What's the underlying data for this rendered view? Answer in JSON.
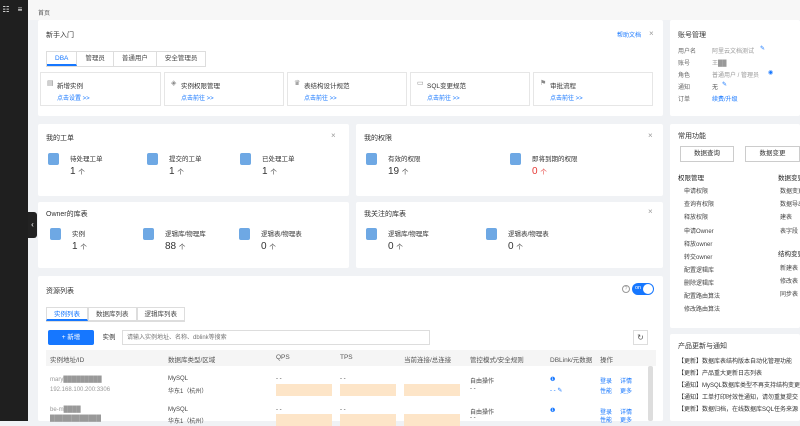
{
  "breadcrumb": "首页",
  "getting_started": {
    "title": "新手入门",
    "help_link": "帮助文档",
    "tabs": [
      "DBA",
      "管理员",
      "普通用户",
      "安全管理员"
    ],
    "items": [
      {
        "title": "新增实例",
        "link": "点击设置 >>"
      },
      {
        "title": "实例权限管理",
        "link": "点击前往 >>"
      },
      {
        "title": "表结构设计规范",
        "link": "点击前往 >>"
      },
      {
        "title": "SQL变更规范",
        "link": "点击前往 >>"
      },
      {
        "title": "审批流程",
        "link": "点击前往 >>"
      }
    ]
  },
  "my_tickets": {
    "title": "我的工单",
    "items": [
      {
        "label": "待处理工单",
        "count": "1",
        "unit": "个"
      },
      {
        "label": "提交的工单",
        "count": "1",
        "unit": "个"
      },
      {
        "label": "已处理工单",
        "count": "1",
        "unit": "个"
      }
    ]
  },
  "my_permissions": {
    "title": "我的权限",
    "items": [
      {
        "label": "有效的权限",
        "count": "19",
        "unit": "个"
      },
      {
        "label": "即将到期的权限",
        "count": "0",
        "unit": "个"
      }
    ]
  },
  "owner_dbs": {
    "title": "Owner的库表",
    "items": [
      {
        "label": "实例",
        "count": "1",
        "unit": "个"
      },
      {
        "label": "逻辑库/物理库",
        "count": "88",
        "unit": "个"
      },
      {
        "label": "逻辑表/物理表",
        "count": "0",
        "unit": "个"
      }
    ]
  },
  "followed_dbs": {
    "title": "我关注的库表",
    "items": [
      {
        "label": "逻辑库/物理库",
        "count": "0",
        "unit": "个"
      },
      {
        "label": "逻辑表/物理表",
        "count": "0",
        "unit": "个"
      }
    ]
  },
  "resources": {
    "title": "资源列表",
    "toggle": "on",
    "tabs": [
      "实例列表",
      "数据库列表",
      "逻辑库列表"
    ],
    "new_button": "+ 新增",
    "filter_label": "实例",
    "search_placeholder": "请输入实例地址、名称、dblink等搜索",
    "columns": [
      "实例地址/ID",
      "数据库类型/区域",
      "QPS",
      "TPS",
      "当前连接/总连接",
      "管控模式/安全规则",
      "DBLink/元数据",
      "操作"
    ],
    "rows": [
      {
        "addr": "mary█████████",
        "sub": "192.168.100.200:3306",
        "type": "MySQL",
        "region": "华东1（杭州）",
        "qps": "- -",
        "tps": "- -",
        "mode": "自由操作",
        "rule": "- -",
        "ops": [
          "登录",
          "详情",
          "性能",
          "更多"
        ]
      },
      {
        "addr": "be-m████",
        "sub": "████████████",
        "type": "MySQL",
        "region": "华东1（杭州）",
        "qps": "- -",
        "tps": "- -",
        "mode": "自由操作",
        "rule": "- -",
        "ops": [
          "登录",
          "详情",
          "性能",
          "更多"
        ]
      }
    ]
  },
  "account": {
    "title": "账号管理",
    "fields": [
      {
        "label": "用户名",
        "value": "阿里云文档测试"
      },
      {
        "label": "账号",
        "value": "王██"
      },
      {
        "label": "角色",
        "value": "普通用户 / 管理员"
      },
      {
        "label": "通知",
        "value": "无"
      },
      {
        "label": "订单",
        "value": "续费/升级"
      }
    ]
  },
  "common": {
    "title": "常用功能",
    "buttons": [
      "数据查询",
      "数据变更"
    ],
    "perm_title": "权限管理",
    "perm_items": [
      "申请权限",
      "查询有权限",
      "释放权限",
      "申请Owner",
      "释放owner",
      "转交owner",
      "配置逻辑库",
      "删除逻辑库",
      "配置路由算法",
      "修改路由算法"
    ],
    "col2_title": "数据变更",
    "col2_items": [
      "数据变更",
      "数据导出",
      "建表",
      "表字段"
    ],
    "col3_title": "结构变更",
    "col3_items": [
      "新建表",
      "修改表",
      "同步表"
    ]
  },
  "updates": {
    "title": "产品更新与通知",
    "items": [
      "【更新】数据库表结构版本自动化管理功能",
      "【更新】产品重大更新日志列表",
      "【通知】MySQL数据库类型不再支持结构变更",
      "【通知】工单打印时效性通知，请勿重复提交",
      "【更新】数据归档，在线数据库SQL任务来源"
    ]
  },
  "colors": {
    "accent": "#1677ff",
    "danger": "#e53935"
  }
}
